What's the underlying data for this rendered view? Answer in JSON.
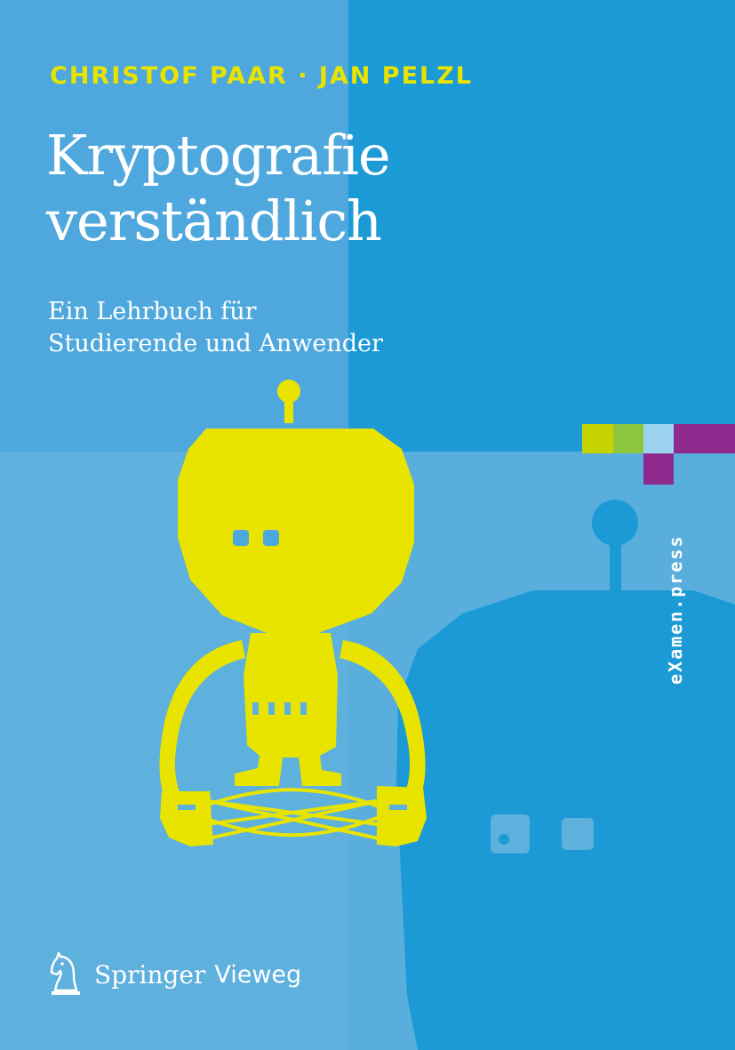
{
  "authors": "CHRISTOF PAAR · JAN PELZL",
  "title": {
    "line1": "Kryptografie",
    "line2": "verständlich"
  },
  "subtitle": {
    "line1": "Ein Lehrbuch für",
    "line2": "Studierende und Anwender"
  },
  "series": "eXamen.press",
  "publisher": {
    "name": "Springer",
    "imprint": "Vieweg",
    "logo_icon": "knight-chess-piece-icon"
  },
  "colors": {
    "yellow": "#e8e400",
    "blue_dark": "#1c9ad6",
    "blue_light": "#5eb0dd",
    "series_blocks": [
      "#c5d300",
      "#8dc63f",
      "#9bd3ef",
      "#8e2a8e",
      "#8e2a8e"
    ]
  }
}
